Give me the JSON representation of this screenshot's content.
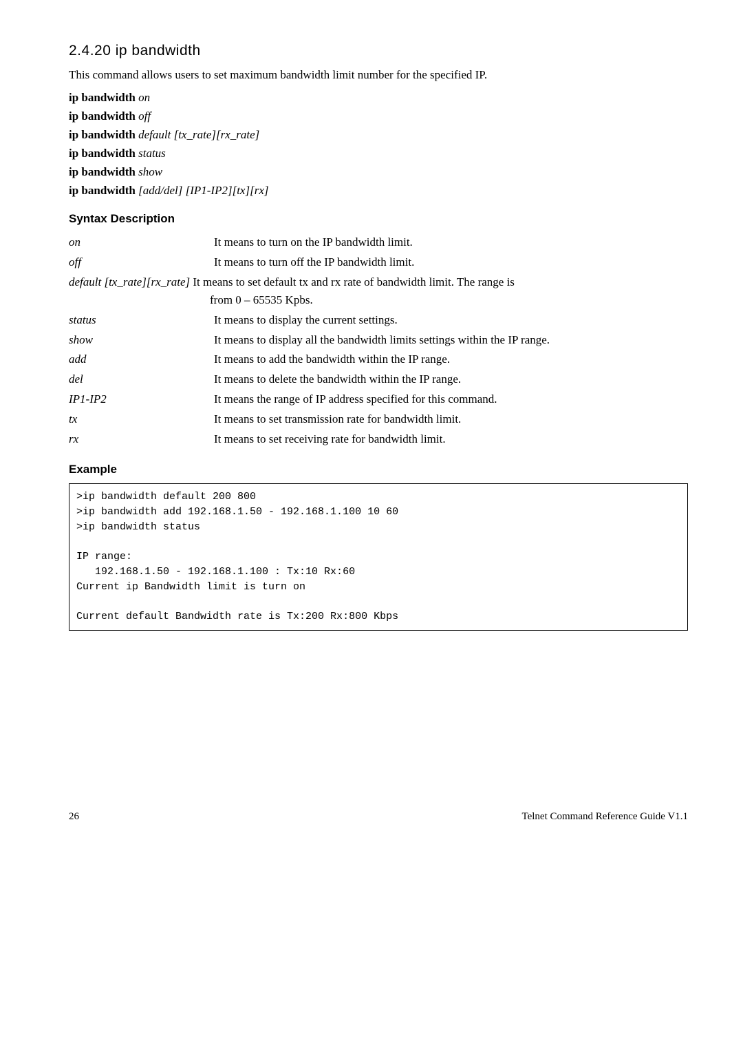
{
  "section": {
    "number": "2.4.20",
    "title": "ip bandwidth"
  },
  "intro": "This command allows users to set maximum bandwidth limit number for the specified IP.",
  "commands": [
    {
      "cmd": "ip bandwidth",
      "arg": "on"
    },
    {
      "cmd": "ip bandwidth",
      "arg": "off"
    },
    {
      "cmd": "ip bandwidth",
      "arg": "default [tx_rate][rx_rate]"
    },
    {
      "cmd": "ip bandwidth",
      "arg": "status"
    },
    {
      "cmd": "ip bandwidth",
      "arg": "show"
    },
    {
      "cmd": "ip bandwidth",
      "arg": "[add/del] [IP1-IP2][tx][rx]"
    }
  ],
  "syntax_heading": "Syntax Description",
  "syntax": [
    {
      "term": "on",
      "def": "It means to turn on the IP bandwidth limit."
    },
    {
      "term": "off",
      "def": "It means to turn off the IP bandwidth limit."
    },
    {
      "term": "default [tx_rate][rx_rate]",
      "def": "It means to set default tx and rx rate of bandwidth limit. The range is from 0 – 65535 Kpbs.",
      "inline": true
    },
    {
      "term": "status",
      "def": "It means to display the current settings."
    },
    {
      "term": "show",
      "def": "It means to display all the bandwidth limits settings within the IP range."
    },
    {
      "term": "add",
      "def": "It means to add the bandwidth within the IP range."
    },
    {
      "term": "del",
      "def": "It means to delete the bandwidth within the IP range."
    },
    {
      "term": "IP1-IP2",
      "def": "It means the range of IP address specified for this command."
    },
    {
      "term": "tx",
      "def": "It means to set transmission rate for bandwidth limit."
    },
    {
      "term": "rx",
      "def": "It means to set receiving rate for bandwidth limit."
    }
  ],
  "example_heading": "Example",
  "example_text": ">ip bandwidth default 200 800\n>ip bandwidth add 192.168.1.50 - 192.168.1.100 10 60\n>ip bandwidth status\n\nIP range:\n   192.168.1.50 - 192.168.1.100 : Tx:10 Rx:60\nCurrent ip Bandwidth limit is turn on\n\nCurrent default Bandwidth rate is Tx:200 Rx:800 Kbps",
  "footer": {
    "page": "26",
    "doc": "Telnet Command Reference Guide V1.1"
  }
}
